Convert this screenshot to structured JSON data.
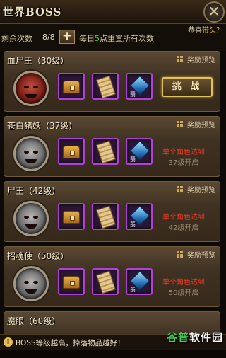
{
  "header": {
    "title": "世界BOSS",
    "close_glyph": "✕"
  },
  "info": {
    "remain_label": "剩余次数",
    "remain_value": "8/8",
    "plus_glyph": "+",
    "reset_prefix": "每日",
    "reset_hour": "5",
    "reset_suffix": "点重置所有次数",
    "marquee_prefix": "恭喜",
    "marquee_highlight": "带头？"
  },
  "reward_preview_label": "奖励预览",
  "bosses": [
    {
      "name": "血尸王（30级）",
      "portrait": "red-demon",
      "action": "挑 战",
      "locked": false
    },
    {
      "name": "苍白猪妖（37级）",
      "portrait": "grey-boar",
      "locked": true,
      "req": "单个角色达到",
      "level": "37级开启"
    },
    {
      "name": "尸王（42级）",
      "portrait": "grey-skull-knight",
      "locked": true,
      "req": "单个角色达到",
      "level": "42级开启"
    },
    {
      "name": "招魂使（50级）",
      "portrait": "grey-horned-demon",
      "locked": true,
      "req": "单个角色达到",
      "level": "50级开启"
    },
    {
      "name": "魔眼（60级）",
      "portrait": "eye-demon",
      "locked": true
    }
  ],
  "reward_items": [
    {
      "icon": "treasure-chest-icon"
    },
    {
      "icon": "gold-scroll-icon"
    },
    {
      "icon": "blue-gem-icon",
      "label": "翡"
    }
  ],
  "notice": {
    "icon": "!",
    "text": "BOSS等级越高，掉落物品越好！"
  },
  "watermark": {
    "part1": "谷普",
    "part2": "软件园"
  },
  "colors": {
    "accent_gold": "#e0c068",
    "locked_red": "#e83c2a",
    "reward_border": "#b040d8",
    "highlight_green": "#40e030"
  }
}
